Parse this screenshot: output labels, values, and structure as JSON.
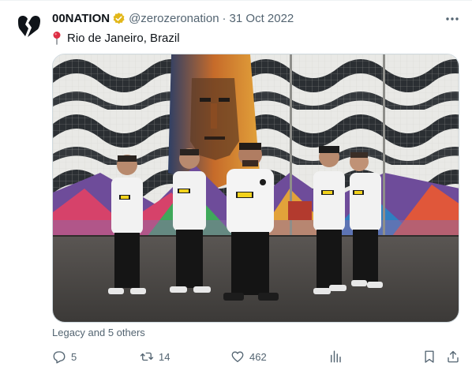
{
  "author": {
    "name": "00NATION",
    "handle": "@zerozeronation",
    "separator": "·",
    "date": "31 Oct 2022"
  },
  "tweet": {
    "location": "Rio de Janeiro, Brazil",
    "liked_by": "Legacy and 5 others"
  },
  "actions": {
    "replies": "5",
    "retweets": "14",
    "likes": "462"
  },
  "icons": {
    "avatar": "broken-heart-logo",
    "verified": "gold-verified-badge",
    "more": "more-horizontal-icon",
    "location": "round-pushpin-emoji",
    "reply": "reply-icon",
    "retweet": "retweet-icon",
    "like": "heart-icon",
    "views": "analytics-icon",
    "bookmark": "bookmark-icon",
    "share": "share-icon"
  },
  "colors": {
    "text_primary": "#0f1419",
    "text_secondary": "#536471",
    "verified_gold": "#e2b719",
    "border": "#cfd9de"
  }
}
